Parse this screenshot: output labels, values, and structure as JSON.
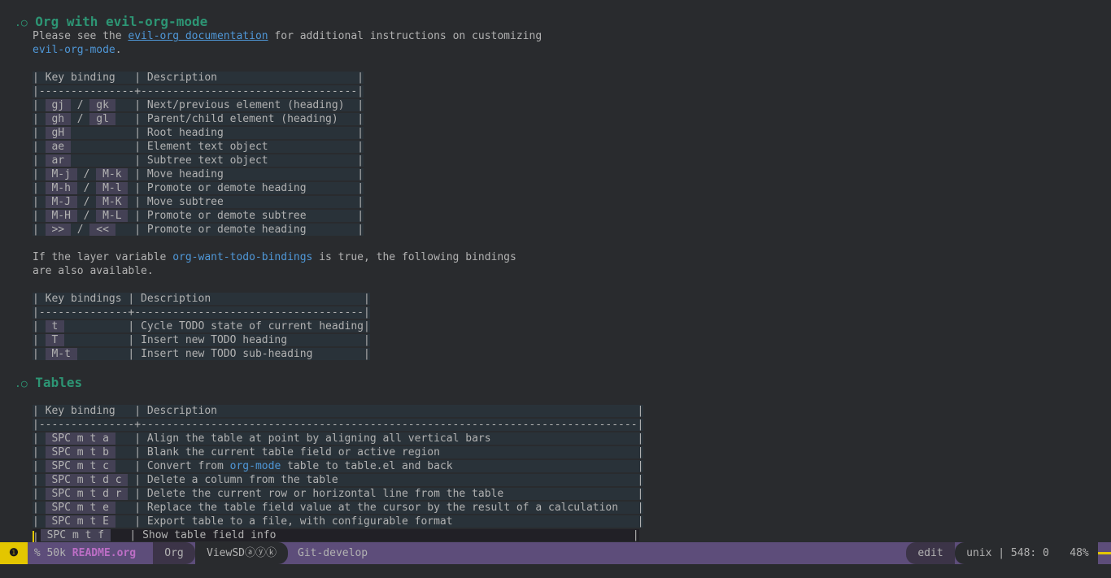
{
  "sections": [
    {
      "title": "Org with evil-org-mode"
    },
    {
      "title": "Tables"
    }
  ],
  "bullet": ".○",
  "intro1": {
    "pre": "Please see the ",
    "link": "evil-org documentation",
    "post": " for additional instructions on customizing",
    "line2_code": "evil-org-mode",
    "line2_post": "."
  },
  "table1": {
    "header": "| Key binding   | Description                      |",
    "sep": "|---------------+----------------------------------|",
    "rows": [
      {
        "key1": "gj",
        "key2": "gk",
        "desc": "Next/previous element (heading)"
      },
      {
        "key1": "gh",
        "key2": "gl",
        "desc": "Parent/child element (heading)"
      },
      {
        "key1": "gH",
        "key2": "",
        "desc": "Root heading"
      },
      {
        "key1": "ae",
        "key2": "",
        "desc": "Element text object"
      },
      {
        "key1": "ar",
        "key2": "",
        "desc": "Subtree text object"
      },
      {
        "key1": "M-j",
        "key2": "M-k",
        "desc": "Move heading"
      },
      {
        "key1": "M-h",
        "key2": "M-l",
        "desc": "Promote or demote heading"
      },
      {
        "key1": "M-J",
        "key2": "M-K",
        "desc": "Move subtree"
      },
      {
        "key1": "M-H",
        "key2": "M-L",
        "desc": "Promote or demote subtree"
      },
      {
        "key1": ">>",
        "key2": "<<",
        "desc": "Promote or demote heading"
      }
    ]
  },
  "para2": {
    "pre": "If the layer variable ",
    "code": "org-want-todo-bindings",
    "post": " is true, the following bindings",
    "line2": "are also available."
  },
  "table2": {
    "header": "| Key bindings | Description                        |",
    "sep": "|--------------+------------------------------------|",
    "rows": [
      {
        "key": "t",
        "desc": "Cycle TODO state of current heading"
      },
      {
        "key": "T",
        "desc": "Insert new TODO heading"
      },
      {
        "key": "M-t",
        "desc": "Insert new TODO sub-heading"
      }
    ]
  },
  "table3": {
    "header": "| Key binding   | Description                                                                  |",
    "sep": "|---------------+------------------------------------------------------------------------------|",
    "rows": [
      {
        "key": "SPC m t a",
        "desc": "Align the table at point by aligning all vertical bars"
      },
      {
        "key": "SPC m t b",
        "desc": "Blank the current table field or active region"
      },
      {
        "key": "SPC m t c",
        "desc_pre": "Convert from ",
        "desc_code": "org-mode",
        "desc_post": " table to table.el and back"
      },
      {
        "key": "SPC m t d c",
        "desc": "Delete a column from the table"
      },
      {
        "key": "SPC m t d r",
        "desc": "Delete the current row or horizontal line from the table"
      },
      {
        "key": "SPC m t e",
        "desc": "Replace the table field value at the cursor by the result of a calculation"
      },
      {
        "key": "SPC m t E",
        "desc": "Export table to a file, with configurable format"
      },
      {
        "key": "SPC m t f",
        "desc": "Show table field info"
      }
    ]
  },
  "modeline": {
    "state_icon": "❶",
    "size": "% 50k ",
    "buffer_name": "README.org",
    "major_mode": "Org",
    "minor_modes": "ViewSDⓐⓨⓚ",
    "vc": "Git-develop",
    "edit_state": "edit",
    "encoding_pos": "unix | 548: 0",
    "percent": "48%"
  },
  "colors": {
    "background": "#292b2e",
    "heading": "#2d9574",
    "link": "#4f97d7",
    "table_bg": "#293239",
    "key_bg": "#444155",
    "modeline": "#5d4d7a",
    "evil_state": "#e3c600"
  }
}
